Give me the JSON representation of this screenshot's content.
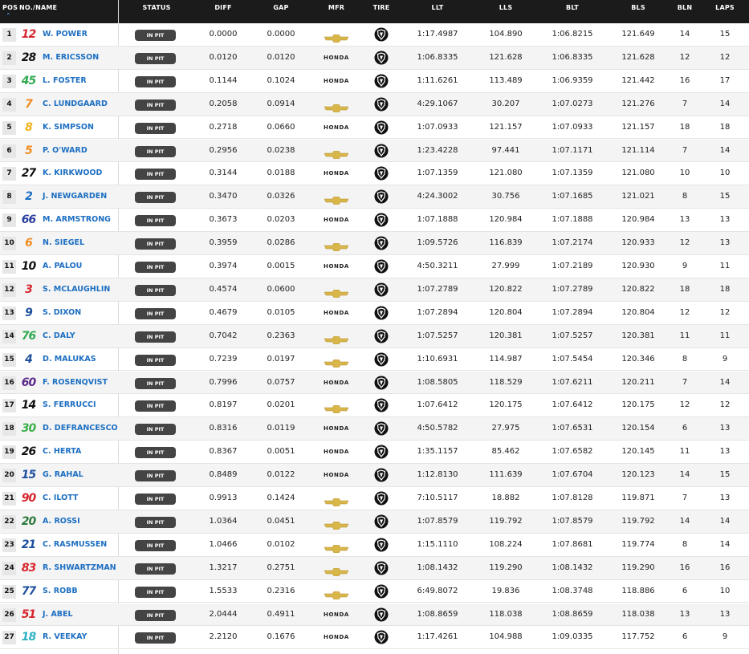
{
  "header": {
    "columns": [
      "POS",
      "NO./NAME",
      "STATUS",
      "DIFF",
      "GAP",
      "MFR",
      "TIRE",
      "LLT",
      "LLS",
      "BLT",
      "BLS",
      "BLN",
      "LAPS"
    ],
    "sort_indicator": "sort-up-icon"
  },
  "status_label": "IN PIT",
  "manufacturer_labels": {
    "honda": "HONDA",
    "chevrolet": "chevrolet-bowtie-icon"
  },
  "tire_icon": "firestone-tire-icon",
  "colors": {
    "header_bg": "#1b1b1b",
    "name_link": "#1d6fc2",
    "badge_bg": "#444444",
    "alt_row": "#f4f4f4",
    "chevy_gold": "#d9b64a"
  },
  "rows": [
    {
      "pos": "1",
      "num": "12",
      "num_color": "#d6262d",
      "name": "W. POWER",
      "status": "IN PIT",
      "diff": "0.0000",
      "gap": "0.0000",
      "mfr": "chevrolet",
      "llt": "1:17.4987",
      "lls": "104.890",
      "blt": "1:06.8215",
      "bls": "121.649",
      "bln": "14",
      "laps": "15"
    },
    {
      "pos": "2",
      "num": "28",
      "num_color": "#111111",
      "name": "M. ERICSSON",
      "status": "IN PIT",
      "diff": "0.0120",
      "gap": "0.0120",
      "mfr": "honda",
      "llt": "1:06.8335",
      "lls": "121.628",
      "blt": "1:06.8335",
      "bls": "121.628",
      "bln": "12",
      "laps": "12"
    },
    {
      "pos": "3",
      "num": "45",
      "num_color": "#2fa84f",
      "name": "L. FOSTER",
      "status": "IN PIT",
      "diff": "0.1144",
      "gap": "0.1024",
      "mfr": "honda",
      "llt": "1:11.6261",
      "lls": "113.489",
      "blt": "1:06.9359",
      "bls": "121.442",
      "bln": "16",
      "laps": "17"
    },
    {
      "pos": "4",
      "num": "7",
      "num_color": "#f28a1e",
      "name": "C. LUNDGAARD",
      "status": "IN PIT",
      "diff": "0.2058",
      "gap": "0.0914",
      "mfr": "chevrolet",
      "llt": "4:29.1067",
      "lls": "30.207",
      "blt": "1:07.0273",
      "bls": "121.276",
      "bln": "7",
      "laps": "14"
    },
    {
      "pos": "5",
      "num": "8",
      "num_color": "#f2b31e",
      "name": "K. SIMPSON",
      "status": "IN PIT",
      "diff": "0.2718",
      "gap": "0.0660",
      "mfr": "honda",
      "llt": "1:07.0933",
      "lls": "121.157",
      "blt": "1:07.0933",
      "bls": "121.157",
      "bln": "18",
      "laps": "18"
    },
    {
      "pos": "6",
      "num": "5",
      "num_color": "#f28a1e",
      "name": "P. O'WARD",
      "status": "IN PIT",
      "diff": "0.2956",
      "gap": "0.0238",
      "mfr": "chevrolet",
      "llt": "1:23.4228",
      "lls": "97.441",
      "blt": "1:07.1171",
      "bls": "121.114",
      "bln": "7",
      "laps": "14"
    },
    {
      "pos": "7",
      "num": "27",
      "num_color": "#111111",
      "name": "K. KIRKWOOD",
      "status": "IN PIT",
      "diff": "0.3144",
      "gap": "0.0188",
      "mfr": "honda",
      "llt": "1:07.1359",
      "lls": "121.080",
      "blt": "1:07.1359",
      "bls": "121.080",
      "bln": "10",
      "laps": "10"
    },
    {
      "pos": "8",
      "num": "2",
      "num_color": "#1d6fc2",
      "name": "J. NEWGARDEN",
      "status": "IN PIT",
      "diff": "0.3470",
      "gap": "0.0326",
      "mfr": "chevrolet",
      "llt": "4:24.3002",
      "lls": "30.756",
      "blt": "1:07.1685",
      "bls": "121.021",
      "bln": "8",
      "laps": "15"
    },
    {
      "pos": "9",
      "num": "66",
      "num_color": "#2a3f9e",
      "name": "M. ARMSTRONG",
      "status": "IN PIT",
      "diff": "0.3673",
      "gap": "0.0203",
      "mfr": "honda",
      "llt": "1:07.1888",
      "lls": "120.984",
      "blt": "1:07.1888",
      "bls": "120.984",
      "bln": "13",
      "laps": "13"
    },
    {
      "pos": "10",
      "num": "6",
      "num_color": "#f28a1e",
      "name": "N. SIEGEL",
      "status": "IN PIT",
      "diff": "0.3959",
      "gap": "0.0286",
      "mfr": "chevrolet",
      "llt": "1:09.5726",
      "lls": "116.839",
      "blt": "1:07.2174",
      "bls": "120.933",
      "bln": "12",
      "laps": "13"
    },
    {
      "pos": "11",
      "num": "10",
      "num_color": "#111111",
      "name": "A. PALOU",
      "status": "IN PIT",
      "diff": "0.3974",
      "gap": "0.0015",
      "mfr": "honda",
      "llt": "4:50.3211",
      "lls": "27.999",
      "blt": "1:07.2189",
      "bls": "120.930",
      "bln": "9",
      "laps": "11"
    },
    {
      "pos": "12",
      "num": "3",
      "num_color": "#d6262d",
      "name": "S. MCLAUGHLIN",
      "status": "IN PIT",
      "diff": "0.4574",
      "gap": "0.0600",
      "mfr": "chevrolet",
      "llt": "1:07.2789",
      "lls": "120.822",
      "blt": "1:07.2789",
      "bls": "120.822",
      "bln": "18",
      "laps": "18"
    },
    {
      "pos": "13",
      "num": "9",
      "num_color": "#1d4f9e",
      "name": "S. DIXON",
      "status": "IN PIT",
      "diff": "0.4679",
      "gap": "0.0105",
      "mfr": "honda",
      "llt": "1:07.2894",
      "lls": "120.804",
      "blt": "1:07.2894",
      "bls": "120.804",
      "bln": "12",
      "laps": "12"
    },
    {
      "pos": "14",
      "num": "76",
      "num_color": "#2fa84f",
      "name": "C. DALY",
      "status": "IN PIT",
      "diff": "0.7042",
      "gap": "0.2363",
      "mfr": "chevrolet",
      "llt": "1:07.5257",
      "lls": "120.381",
      "blt": "1:07.5257",
      "bls": "120.381",
      "bln": "11",
      "laps": "11"
    },
    {
      "pos": "15",
      "num": "4",
      "num_color": "#1d4f9e",
      "name": "D. MALUKAS",
      "status": "IN PIT",
      "diff": "0.7239",
      "gap": "0.0197",
      "mfr": "chevrolet",
      "llt": "1:10.6931",
      "lls": "114.987",
      "blt": "1:07.5454",
      "bls": "120.346",
      "bln": "8",
      "laps": "9"
    },
    {
      "pos": "16",
      "num": "60",
      "num_color": "#5a2a8a",
      "name": "F. ROSENQVIST",
      "status": "IN PIT",
      "diff": "0.7996",
      "gap": "0.0757",
      "mfr": "honda",
      "llt": "1:08.5805",
      "lls": "118.529",
      "blt": "1:07.6211",
      "bls": "120.211",
      "bln": "7",
      "laps": "14"
    },
    {
      "pos": "17",
      "num": "14",
      "num_color": "#111111",
      "name": "S. FERRUCCI",
      "status": "IN PIT",
      "diff": "0.8197",
      "gap": "0.0201",
      "mfr": "chevrolet",
      "llt": "1:07.6412",
      "lls": "120.175",
      "blt": "1:07.6412",
      "bls": "120.175",
      "bln": "12",
      "laps": "12"
    },
    {
      "pos": "18",
      "num": "30",
      "num_color": "#3cb04a",
      "name": "D. DEFRANCESCO",
      "status": "IN PIT",
      "diff": "0.8316",
      "gap": "0.0119",
      "mfr": "honda",
      "llt": "4:50.5782",
      "lls": "27.975",
      "blt": "1:07.6531",
      "bls": "120.154",
      "bln": "6",
      "laps": "13"
    },
    {
      "pos": "19",
      "num": "26",
      "num_color": "#111111",
      "name": "C. HERTA",
      "status": "IN PIT",
      "diff": "0.8367",
      "gap": "0.0051",
      "mfr": "honda",
      "llt": "1:35.1157",
      "lls": "85.462",
      "blt": "1:07.6582",
      "bls": "120.145",
      "bln": "11",
      "laps": "13"
    },
    {
      "pos": "20",
      "num": "15",
      "num_color": "#1d4f9e",
      "name": "G. RAHAL",
      "status": "IN PIT",
      "diff": "0.8489",
      "gap": "0.0122",
      "mfr": "honda",
      "llt": "1:12.8130",
      "lls": "111.639",
      "blt": "1:07.6704",
      "bls": "120.123",
      "bln": "14",
      "laps": "15"
    },
    {
      "pos": "21",
      "num": "90",
      "num_color": "#d6262d",
      "name": "C. ILOTT",
      "status": "IN PIT",
      "diff": "0.9913",
      "gap": "0.1424",
      "mfr": "chevrolet",
      "llt": "7:10.5117",
      "lls": "18.882",
      "blt": "1:07.8128",
      "bls": "119.871",
      "bln": "7",
      "laps": "13"
    },
    {
      "pos": "22",
      "num": "20",
      "num_color": "#2f7a3c",
      "name": "A. ROSSI",
      "status": "IN PIT",
      "diff": "1.0364",
      "gap": "0.0451",
      "mfr": "chevrolet",
      "llt": "1:07.8579",
      "lls": "119.792",
      "blt": "1:07.8579",
      "bls": "119.792",
      "bln": "14",
      "laps": "14"
    },
    {
      "pos": "23",
      "num": "21",
      "num_color": "#1d4f9e",
      "name": "C. RASMUSSEN",
      "status": "IN PIT",
      "diff": "1.0466",
      "gap": "0.0102",
      "mfr": "chevrolet",
      "llt": "1:15.1110",
      "lls": "108.224",
      "blt": "1:07.8681",
      "bls": "119.774",
      "bln": "8",
      "laps": "14"
    },
    {
      "pos": "24",
      "num": "83",
      "num_color": "#d6262d",
      "name": "R. SHWARTZMAN",
      "status": "IN PIT",
      "diff": "1.3217",
      "gap": "0.2751",
      "mfr": "chevrolet",
      "llt": "1:08.1432",
      "lls": "119.290",
      "blt": "1:08.1432",
      "bls": "119.290",
      "bln": "16",
      "laps": "16"
    },
    {
      "pos": "25",
      "num": "77",
      "num_color": "#1d4f9e",
      "name": "S. ROBB",
      "status": "IN PIT",
      "diff": "1.5533",
      "gap": "0.2316",
      "mfr": "chevrolet",
      "llt": "6:49.8072",
      "lls": "19.836",
      "blt": "1:08.3748",
      "bls": "118.886",
      "bln": "6",
      "laps": "10"
    },
    {
      "pos": "26",
      "num": "51",
      "num_color": "#d6262d",
      "name": "J. ABEL",
      "status": "IN PIT",
      "diff": "2.0444",
      "gap": "0.4911",
      "mfr": "honda",
      "llt": "1:08.8659",
      "lls": "118.038",
      "blt": "1:08.8659",
      "bls": "118.038",
      "bln": "13",
      "laps": "13"
    },
    {
      "pos": "27",
      "num": "18",
      "num_color": "#2bb0c4",
      "name": "R. VEEKAY",
      "status": "IN PIT",
      "diff": "2.2120",
      "gap": "0.1676",
      "mfr": "honda",
      "llt": "1:17.4261",
      "lls": "104.988",
      "blt": "1:09.0335",
      "bls": "117.752",
      "bln": "6",
      "laps": "9"
    }
  ]
}
